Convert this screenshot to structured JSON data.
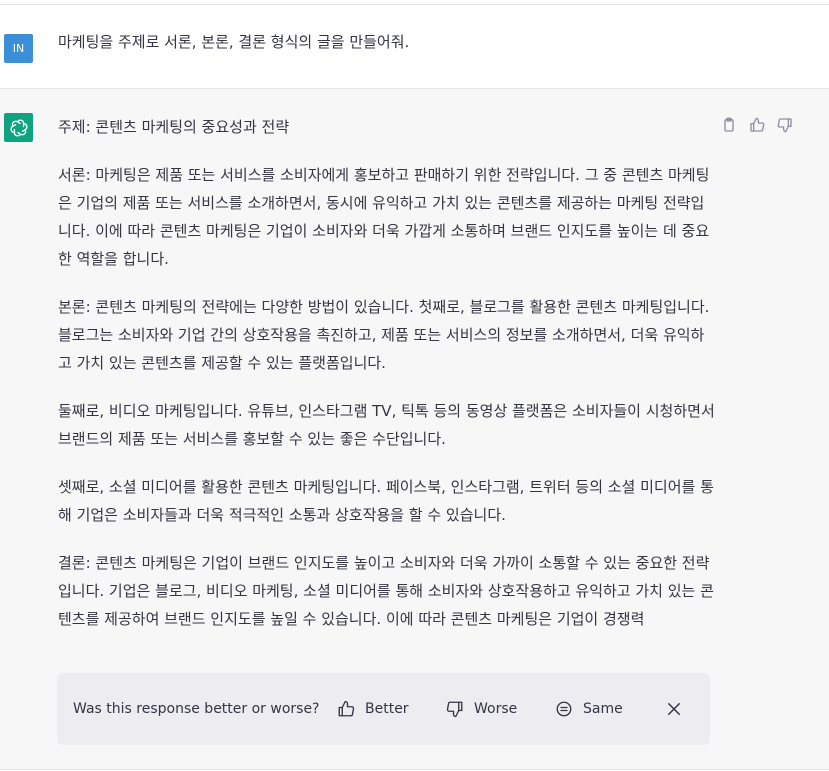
{
  "user_message": {
    "avatar_initials": "IN",
    "avatar_color": "#3b8fd6",
    "text": "마케팅을 주제로 서론, 본론, 결론 형식의 글을 만들어줘."
  },
  "assistant_message": {
    "avatar_color": "#10a37f",
    "avatar_icon": "openai-logo-icon",
    "subject": "주제: 콘텐츠 마케팅의 중요성과 전략",
    "paragraphs": [
      "서론: 마케팅은 제품 또는 서비스를 소비자에게 홍보하고 판매하기 위한 전략입니다. 그 중 콘텐츠 마케팅은 기업의 제품 또는 서비스를 소개하면서, 동시에 유익하고 가치 있는 콘텐츠를 제공하는 마케팅 전략입니다. 이에 따라 콘텐츠 마케팅은 기업이 소비자와 더욱 가깝게 소통하며 브랜드 인지도를 높이는 데 중요한 역할을 합니다.",
      "본론: 콘텐츠 마케팅의 전략에는 다양한 방법이 있습니다. 첫째로, 블로그를 활용한 콘텐츠 마케팅입니다. 블로그는 소비자와 기업 간의 상호작용을 촉진하고, 제품 또는 서비스의 정보를 소개하면서, 더욱 유익하고 가치 있는 콘텐츠를 제공할 수 있는 플랫폼입니다.",
      "둘째로, 비디오 마케팅입니다. 유튜브, 인스타그램 TV, 틱톡 등의 동영상 플랫폼은 소비자들이 시청하면서 브랜드의 제품 또는 서비스를 홍보할 수 있는 좋은 수단입니다.",
      "셋째로, 소셜 미디어를 활용한 콘텐츠 마케팅입니다. 페이스북, 인스타그램, 트위터 등의 소셜 미디어를 통해 기업은 소비자들과 더욱 적극적인 소통과 상호작용을 할 수 있습니다.",
      "결론: 콘텐츠 마케팅은 기업이 브랜드 인지도를 높이고 소비자와 더욱 가까이 소통할 수 있는 중요한 전략입니다. 기업은 블로그, 비디오 마케팅, 소셜 미디어를 통해 소비자와 상호작용하고 유익하고 가치 있는 콘텐츠를 제공하여 브랜드 인지도를 높일 수 있습니다. 이에 따라 콘텐츠 마케팅은 기업이 경쟁력"
    ],
    "action_icons": [
      "clipboard-icon",
      "thumbs-up-icon",
      "thumbs-down-icon"
    ]
  },
  "feedback": {
    "question": "Was this response better or worse?",
    "better_label": "Better",
    "worse_label": "Worse",
    "same_label": "Same"
  }
}
